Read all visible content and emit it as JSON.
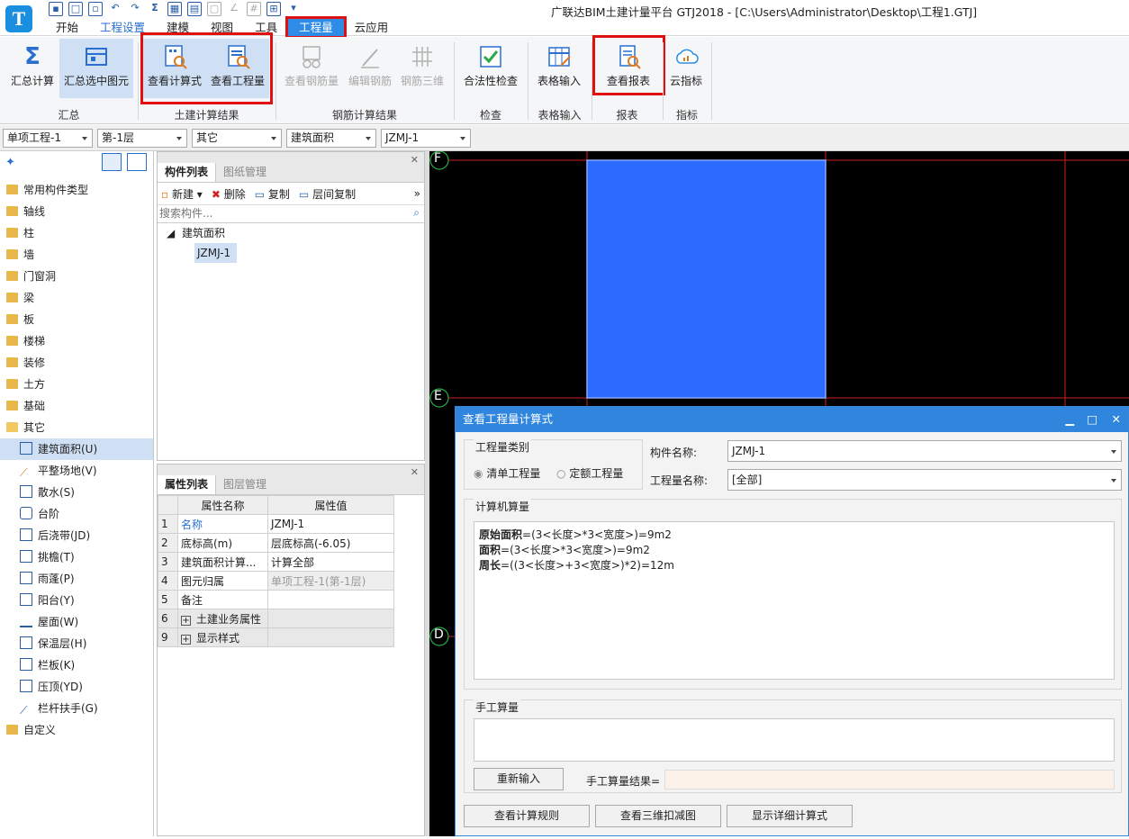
{
  "window": {
    "title": "广联达BIM土建计量平台 GTJ2018 - [C:\\Users\\Administrator\\Desktop\\工程1.GTJ]",
    "logo": "T"
  },
  "menu_tabs": [
    "开始",
    "工程设置",
    "建模",
    "视图",
    "工具",
    "工程量",
    "云应用"
  ],
  "ribbon": {
    "buttons": [
      "汇总计算",
      "汇总选中图元",
      "查看计算式",
      "查看工程量",
      "查看钢筋量",
      "编辑钢筋",
      "钢筋三维",
      "合法性检查",
      "表格输入",
      "查看报表",
      "云指标"
    ],
    "groups": [
      "汇总",
      "土建计算结果",
      "钢筋计算结果",
      "检查",
      "表格输入",
      "报表",
      "指标"
    ]
  },
  "combos": [
    "单项工程-1",
    "第-1层",
    "其它",
    "建筑面积",
    "JZMJ-1"
  ],
  "tree": {
    "root_items": [
      "常用构件类型",
      "轴线",
      "柱",
      "墙",
      "门窗洞",
      "梁",
      "板",
      "楼梯",
      "装修",
      "土方",
      "基础",
      "其它"
    ],
    "children": [
      "建筑面积(U)",
      "平整场地(V)",
      "散水(S)",
      "台阶",
      "后浇带(JD)",
      "挑檐(T)",
      "雨蓬(P)",
      "阳台(Y)",
      "屋面(W)",
      "保温层(H)",
      "栏板(K)",
      "压顶(YD)",
      "栏杆扶手(G)"
    ],
    "last": "自定义"
  },
  "component_panel": {
    "tabs": [
      "构件列表",
      "图纸管理"
    ],
    "toolbar": [
      "新建",
      "删除",
      "复制",
      "层间复制"
    ],
    "search_placeholder": "搜索构件...",
    "group": "建筑面积",
    "item": "JZMJ-1"
  },
  "property_panel": {
    "tabs": [
      "属性列表",
      "图层管理"
    ],
    "headers": [
      "属性名称",
      "属性值"
    ],
    "rows": [
      {
        "n": "1",
        "name": "名称",
        "value": "JZMJ-1"
      },
      {
        "n": "2",
        "name": "底标高(m)",
        "value": "层底标高(-6.05)"
      },
      {
        "n": "3",
        "name": "建筑面积计算...",
        "value": "计算全部"
      },
      {
        "n": "4",
        "name": "图元归属",
        "value": "单项工程-1(第-1层)"
      },
      {
        "n": "5",
        "name": "备注",
        "value": ""
      },
      {
        "n": "6",
        "name": "土建业务属性",
        "value": ""
      },
      {
        "n": "9",
        "name": "显示样式",
        "value": ""
      }
    ]
  },
  "canvas": {
    "axes": [
      "F",
      "E",
      "D"
    ]
  },
  "dialog": {
    "title": "查看工程量计算式",
    "type_group": "工程量类别",
    "radio1": "清单工程量",
    "radio2": "定额工程量",
    "comp_label": "构件名称:",
    "comp_value": "JZMJ-1",
    "qty_label": "工程量名称:",
    "qty_value": "[全部]",
    "computer_section": "计算机算量",
    "formulas": [
      {
        "label": "原始面积",
        "expr": "=(3<长度>*3<宽度>)=9m2"
      },
      {
        "label": "面积",
        "expr": "=(3<长度>*3<宽度>)=9m2"
      },
      {
        "label": "周长",
        "expr": "=((3<长度>+3<宽度>)*2)=12m"
      }
    ],
    "manual_section": "手工算量",
    "reinput": "重新输入",
    "manual_result": "手工算量结果=",
    "btn_rule": "查看计算规则",
    "btn_3d": "查看三维扣减图",
    "btn_detail": "显示详细计算式"
  }
}
